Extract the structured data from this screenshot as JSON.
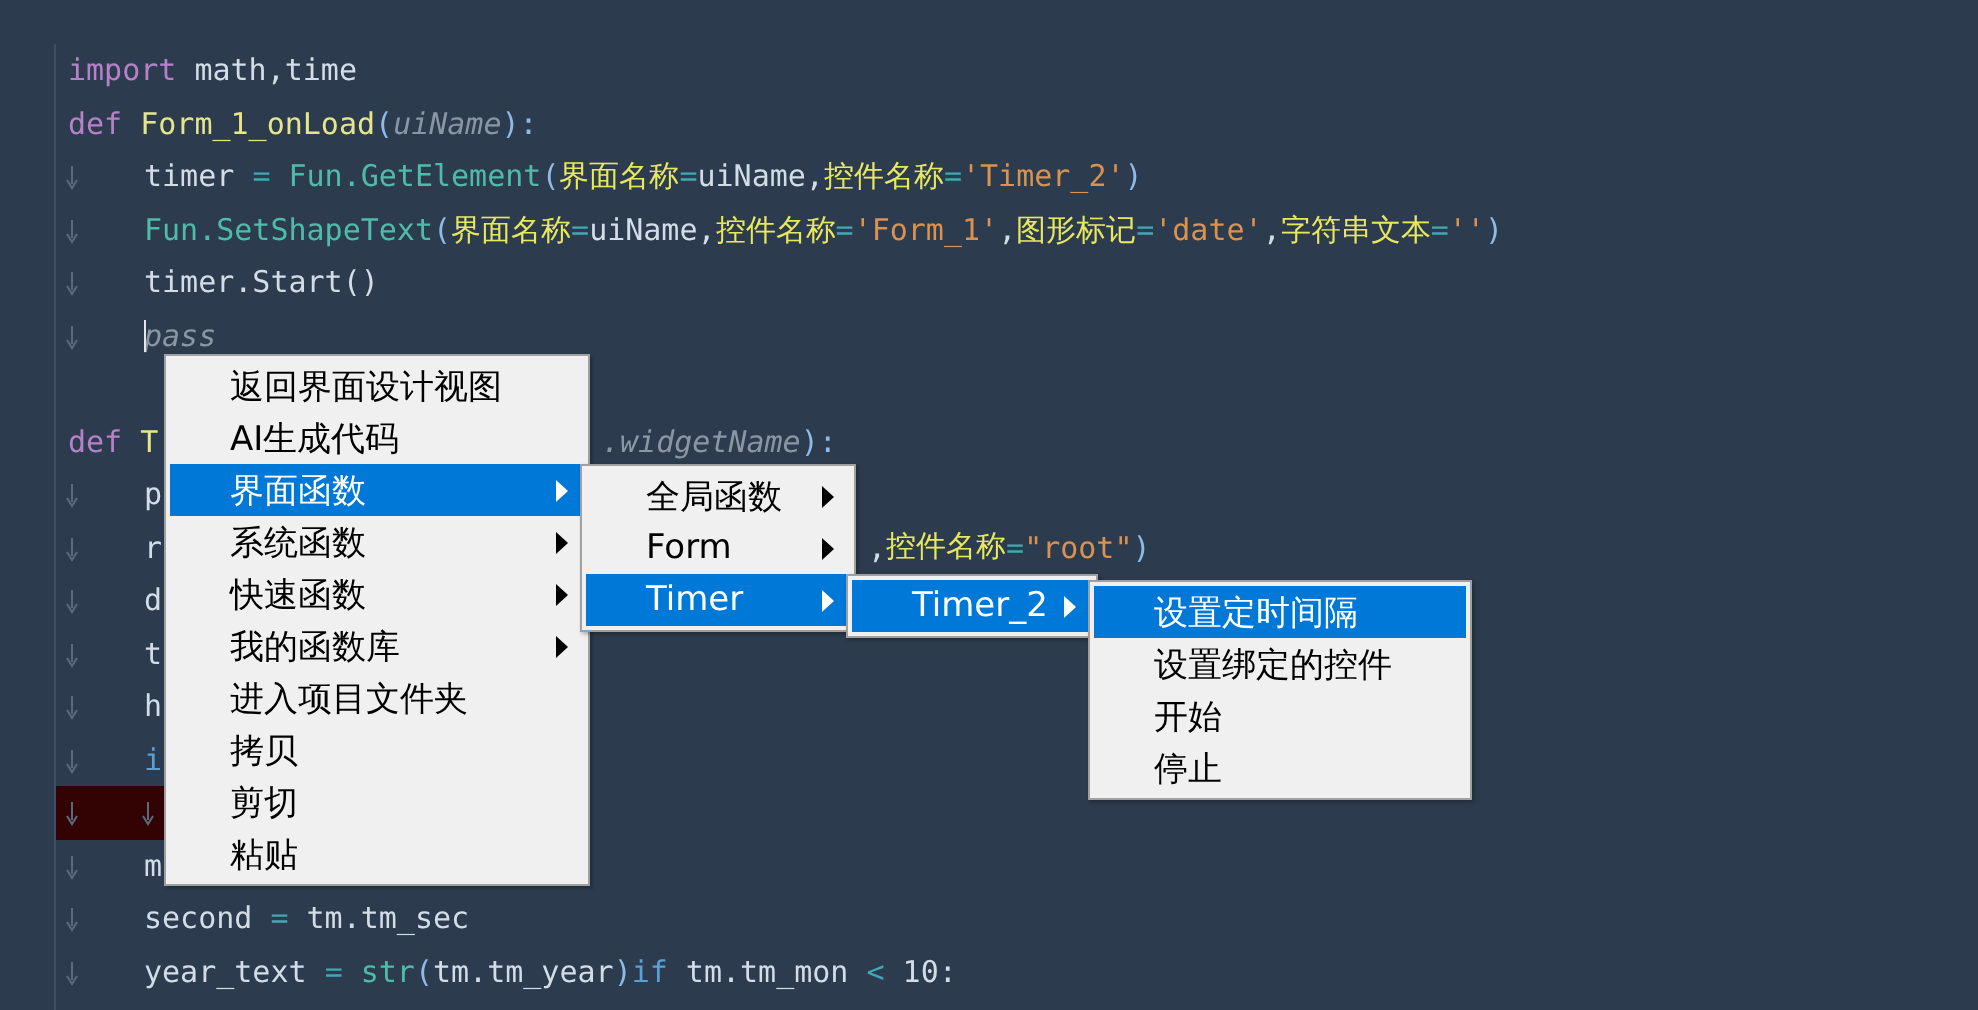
{
  "editor": {
    "lines": [
      {
        "tokens": [
          {
            "kind": "kw",
            "text": "import"
          },
          {
            "kind": "plain",
            "text": " math,time"
          }
        ]
      },
      {
        "tokens": [
          {
            "kind": "kw",
            "text": "def"
          },
          {
            "kind": "fn",
            "text": " Form_1_onLoad"
          },
          {
            "kind": "punc",
            "text": "("
          },
          {
            "kind": "param",
            "text": "uiName"
          },
          {
            "kind": "punc",
            "text": "):"
          }
        ],
        "children": [
          {
            "tokens": [
              {
                "kind": "plain",
                "text": "timer "
              },
              {
                "kind": "op",
                "text": "="
              },
              {
                "kind": "call",
                "text": " Fun.GetElement"
              },
              {
                "kind": "punc",
                "text": "("
              },
              {
                "kind": "arg",
                "text": "界面名称"
              },
              {
                "kind": "op",
                "text": "="
              },
              {
                "kind": "plain",
                "text": "uiName,"
              },
              {
                "kind": "arg",
                "text": "控件名称"
              },
              {
                "kind": "op",
                "text": "="
              },
              {
                "kind": "str",
                "text": "'Timer_2'"
              },
              {
                "kind": "punc",
                "text": ")"
              }
            ]
          },
          {
            "tokens": [
              {
                "kind": "call",
                "text": "Fun.SetShapeText"
              },
              {
                "kind": "punc",
                "text": "("
              },
              {
                "kind": "arg",
                "text": "界面名称"
              },
              {
                "kind": "op",
                "text": "="
              },
              {
                "kind": "plain",
                "text": "uiName,"
              },
              {
                "kind": "arg",
                "text": "控件名称"
              },
              {
                "kind": "op",
                "text": "="
              },
              {
                "kind": "str",
                "text": "'Form_1'"
              },
              {
                "kind": "plain",
                "text": ","
              },
              {
                "kind": "arg",
                "text": "图形标记"
              },
              {
                "kind": "op",
                "text": "="
              },
              {
                "kind": "str",
                "text": "'date'"
              },
              {
                "kind": "plain",
                "text": ","
              },
              {
                "kind": "arg",
                "text": "字符串文本"
              },
              {
                "kind": "op",
                "text": "="
              },
              {
                "kind": "str",
                "text": "''"
              },
              {
                "kind": "punc",
                "text": ")"
              }
            ]
          },
          {
            "tokens": [
              {
                "kind": "plain",
                "text": "timer.Start()"
              }
            ]
          },
          {
            "cursor": true,
            "tokens": [
              {
                "kind": "muted",
                "text": "pass"
              }
            ]
          }
        ]
      },
      {
        "blank_before": true,
        "tokens": [
          {
            "kind": "kw",
            "text": "def"
          },
          {
            "kind": "fn",
            "text": " T"
          }
        ],
        "tail": {
          "tokens": [
            {
              "kind": "param",
              "text": ".widgetName"
            },
            {
              "kind": "punc",
              "text": "):"
            }
          ]
        },
        "children": [
          {
            "tokens": [
              {
                "kind": "plain",
                "text": "p"
              }
            ]
          },
          {
            "tokens": [
              {
                "kind": "plain",
                "text": "r"
              }
            ],
            "tail": {
              "tokens": [
                {
                  "kind": "plain",
                  "text": ","
                },
                {
                  "kind": "arg",
                  "text": "控件名称"
                },
                {
                  "kind": "op",
                  "text": "="
                },
                {
                  "kind": "str",
                  "text": "\"root\""
                },
                {
                  "kind": "punc",
                  "text": ")"
                }
              ]
            }
          },
          {
            "tokens": [
              {
                "kind": "plain",
                "text": "d"
              }
            ]
          },
          {
            "tokens": [
              {
                "kind": "plain",
                "text": "t"
              }
            ]
          },
          {
            "tokens": [
              {
                "kind": "plain",
                "text": "h"
              }
            ]
          },
          {
            "tokens": [
              {
                "kind": "kw2",
                "text": "i"
              }
            ],
            "children": [
              {
                "highlighted": true
              }
            ]
          },
          {
            "tokens": [
              {
                "kind": "plain",
                "text": "m"
              }
            ]
          },
          {
            "tokens": [
              {
                "kind": "plain",
                "text": "second "
              },
              {
                "kind": "op",
                "text": "="
              },
              {
                "kind": "plain",
                "text": " tm.tm_sec"
              }
            ]
          },
          {
            "tokens": [
              {
                "kind": "plain",
                "text": "year_text "
              },
              {
                "kind": "op",
                "text": "="
              },
              {
                "kind": "call",
                "text": " str"
              },
              {
                "kind": "punc",
                "text": "("
              },
              {
                "kind": "plain",
                "text": "tm.tm_year"
              },
              {
                "kind": "punc",
                "text": ")"
              },
              {
                "kind": "kw2",
                "text": "if"
              },
              {
                "kind": "plain",
                "text": " tm.tm_mon "
              },
              {
                "kind": "op",
                "text": "<"
              },
              {
                "kind": "plain",
                "text": " 10:"
              }
            ]
          }
        ]
      }
    ]
  },
  "context_menu": {
    "items": [
      {
        "label": "返回界面设计视图",
        "selected": false,
        "has_submenu": false
      },
      {
        "label": "AI生成代码",
        "selected": false,
        "has_submenu": false
      },
      {
        "label": "界面函数",
        "selected": true,
        "has_submenu": true,
        "children": [
          {
            "label": "全局函数",
            "selected": false,
            "has_submenu": true
          },
          {
            "label": "Form",
            "selected": false,
            "has_submenu": true
          },
          {
            "label": "Timer",
            "selected": true,
            "has_submenu": true,
            "children": [
              {
                "label": "Timer_2",
                "selected": true,
                "has_submenu": true,
                "children": [
                  {
                    "label": "设置定时间隔",
                    "selected": true,
                    "has_submenu": false
                  },
                  {
                    "label": "设置绑定的控件",
                    "selected": false,
                    "has_submenu": false
                  },
                  {
                    "label": "开始",
                    "selected": false,
                    "has_submenu": false
                  },
                  {
                    "label": "停止",
                    "selected": false,
                    "has_submenu": false
                  }
                ]
              }
            ]
          }
        ]
      },
      {
        "label": "系统函数",
        "selected": false,
        "has_submenu": true
      },
      {
        "label": "快速函数",
        "selected": false,
        "has_submenu": true
      },
      {
        "label": "我的函数库",
        "selected": false,
        "has_submenu": true
      },
      {
        "label": "进入项目文件夹",
        "selected": false,
        "has_submenu": false
      },
      {
        "label": "拷贝",
        "selected": false,
        "has_submenu": false
      },
      {
        "label": "剪切",
        "selected": false,
        "has_submenu": false
      },
      {
        "label": "粘贴",
        "selected": false,
        "has_submenu": false
      }
    ]
  }
}
